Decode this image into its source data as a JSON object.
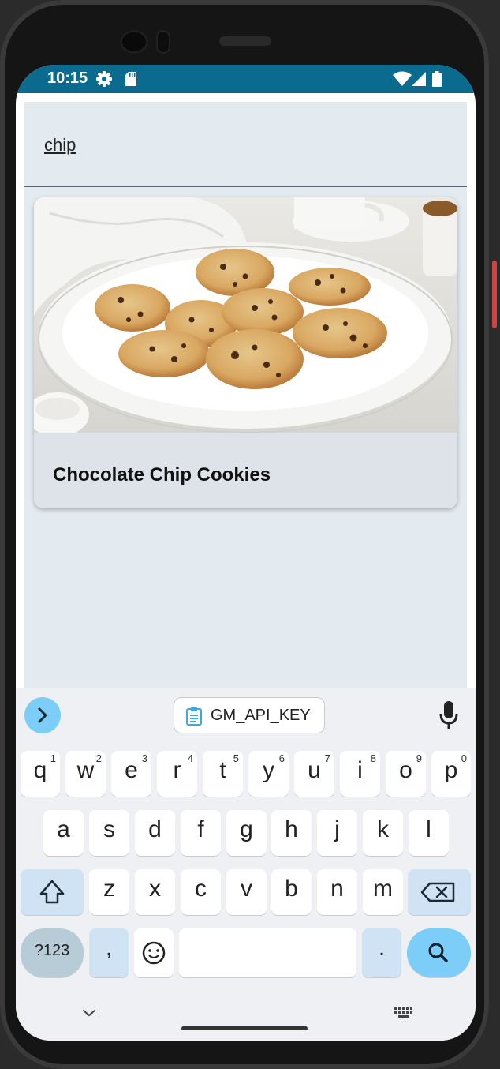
{
  "status": {
    "time": "10:15",
    "icons": [
      "gear-icon",
      "sdcard-icon",
      "wifi-icon",
      "signal-icon",
      "battery-icon"
    ]
  },
  "search": {
    "value": "chip"
  },
  "results": [
    {
      "title": "Chocolate Chip Cookies",
      "image": "chocolate chip cookies on a white plate"
    }
  ],
  "keyboard": {
    "clipboard_suggestion": "GM_API_KEY",
    "row1": [
      {
        "label": "q",
        "hint": "1"
      },
      {
        "label": "w",
        "hint": "2"
      },
      {
        "label": "e",
        "hint": "3"
      },
      {
        "label": "r",
        "hint": "4"
      },
      {
        "label": "t",
        "hint": "5"
      },
      {
        "label": "y",
        "hint": "6"
      },
      {
        "label": "u",
        "hint": "7"
      },
      {
        "label": "i",
        "hint": "8"
      },
      {
        "label": "o",
        "hint": "9"
      },
      {
        "label": "p",
        "hint": "0"
      }
    ],
    "row2": [
      "a",
      "s",
      "d",
      "f",
      "g",
      "h",
      "j",
      "k",
      "l"
    ],
    "row3": [
      "z",
      "x",
      "c",
      "v",
      "b",
      "n",
      "m"
    ],
    "symbols_label": "?123",
    "comma_label": ",",
    "period_label": "."
  },
  "colors": {
    "status_bar": "#0a6b8e",
    "app_background": "#e3ebf1",
    "card_background": "#dee3e9",
    "accent": "#7ccdf7"
  }
}
